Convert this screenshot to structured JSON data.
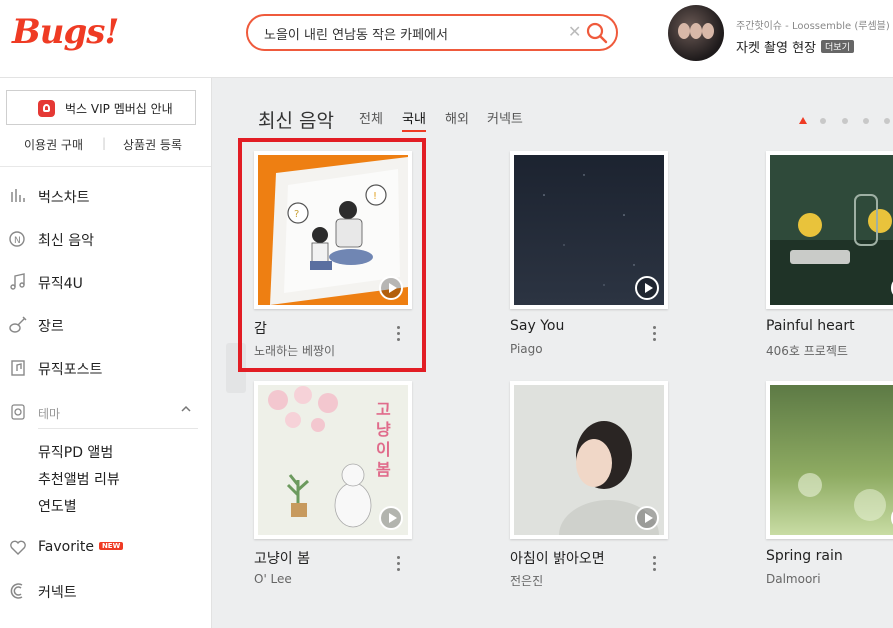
{
  "brand": {
    "logo": "Bugs!"
  },
  "search": {
    "value": "노을이 내린 연남동 작은 카페에서",
    "clear": "✕"
  },
  "promo": {
    "subtitle": "주간핫이슈 - Loossemble (루셈블)",
    "title": "자켓 촬영 현장",
    "more": "더보기"
  },
  "sidebar": {
    "vip_label": "벅스 VIP 멤버십 안내",
    "voucher_buy": "이용권 구매",
    "separator": "|",
    "coupon_register": "상품권 등록",
    "nav": [
      {
        "label": "벅스차트"
      },
      {
        "label": "최신 음악"
      },
      {
        "label": "뮤직4U"
      },
      {
        "label": "장르"
      },
      {
        "label": "뮤직포스트"
      }
    ],
    "theme_label": "테마",
    "theme_items": [
      "뮤직PD 앨범",
      "추천앨범 리뷰",
      "연도별"
    ],
    "favorite": "Favorite",
    "new_badge": "NEW",
    "connect": "커넥트"
  },
  "main": {
    "title": "최신 음악",
    "tabs": [
      "전체",
      "국내",
      "해외",
      "커넥트"
    ],
    "active_tab": "국내",
    "albums": [
      {
        "title": "감",
        "artist": "노래하는 베짱이"
      },
      {
        "title": "Say You",
        "artist": "Piago"
      },
      {
        "title": "Painful heart",
        "artist": "406호 프로젝트"
      },
      {
        "title": "고냥이 봄",
        "artist": "O' Lee"
      },
      {
        "title": "아침이 밝아오면",
        "artist": "전은진"
      },
      {
        "title": "Spring rain",
        "artist": "Dalmoori"
      }
    ]
  },
  "colors": {
    "accent": "#ef3b24",
    "highlight": "#e21d24",
    "main_bg": "#edeeef"
  },
  "icons": [
    "search-icon",
    "clear-icon",
    "chart-icon",
    "new-music-icon",
    "music4u-icon",
    "genre-icon",
    "musicpost-icon",
    "theme-icon",
    "heart-icon",
    "connect-icon",
    "play-icon",
    "more-icon"
  ]
}
